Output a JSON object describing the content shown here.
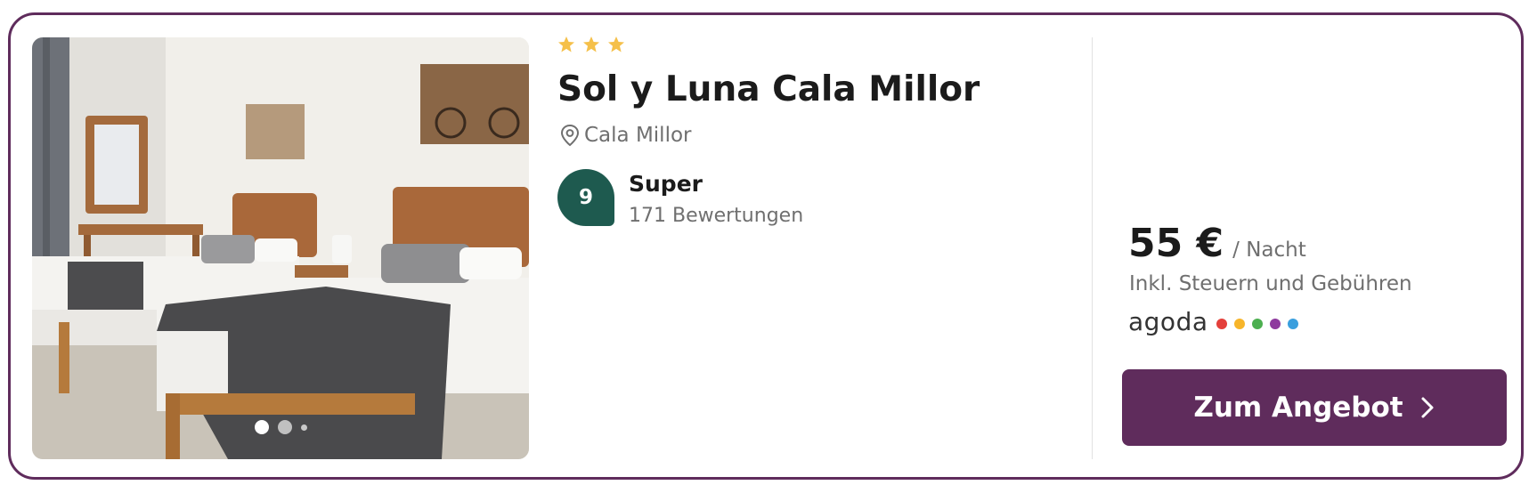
{
  "hotel": {
    "star_count": 3,
    "name": "Sol y Luna Cala Millor",
    "location": "Cala Millor",
    "rating": {
      "score": "9",
      "label": "Super",
      "reviews": "171 Bewertungen"
    }
  },
  "gallery": {
    "photo_count": 3,
    "active_index": 0
  },
  "offer": {
    "price": "55 €",
    "unit": "/ Nacht",
    "note": "Inkl. Steuern und Gebühren",
    "provider": "agoda",
    "provider_colors": [
      "#e4403b",
      "#f7b52a",
      "#4caf50",
      "#8e3a9e",
      "#3a9fde"
    ],
    "cta_label": "Zum Angebot"
  },
  "colors": {
    "brand": "#5f2c5c",
    "rating_badge": "#1e5a4f",
    "star": "#f5c04a"
  },
  "icons": {
    "star": "star-icon",
    "location": "location-pin-icon",
    "cta_arrow": "chevron-right-icon"
  }
}
